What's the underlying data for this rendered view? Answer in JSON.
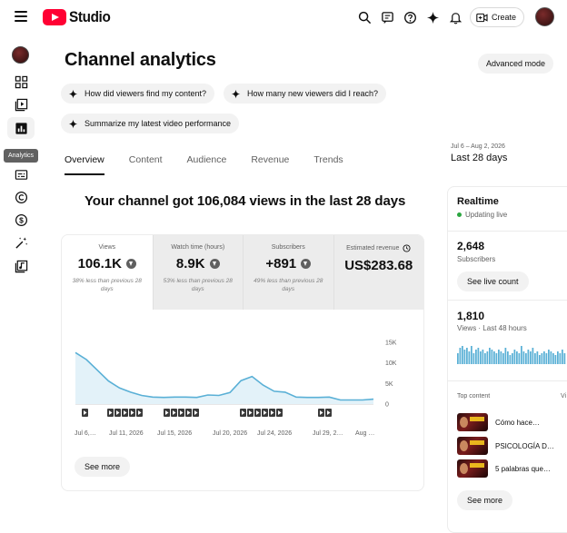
{
  "app": {
    "brand": "Studio"
  },
  "header": {
    "create_label": "Create"
  },
  "sidebar": {
    "tooltip": "Analytics",
    "items": [
      {
        "icon": "dashboard-icon"
      },
      {
        "icon": "content-icon"
      },
      {
        "icon": "analytics-icon"
      },
      {
        "icon": "comments-icon"
      },
      {
        "icon": "subtitles-icon"
      },
      {
        "icon": "copyright-icon"
      },
      {
        "icon": "earn-icon"
      },
      {
        "icon": "customization-icon"
      },
      {
        "icon": "audio-library-icon"
      }
    ]
  },
  "main": {
    "title": "Channel analytics",
    "advanced_mode_label": "Advanced mode",
    "suggestions": [
      "How did viewers find my content?",
      "How many new viewers did I reach?",
      "Summarize my latest video performance"
    ],
    "tabs": [
      "Overview",
      "Content",
      "Audience",
      "Revenue",
      "Trends"
    ],
    "active_tab": "Overview",
    "date_range": "Jul 6 – Aug 2, 2026",
    "date_label": "Last 28 days",
    "headline": "Your channel got 106,084 views in the last 28 days",
    "metrics": [
      {
        "label": "Views",
        "value": "106.1K",
        "note": "38% less than previous 28 days",
        "trend": "down"
      },
      {
        "label": "Watch time (hours)",
        "value": "8.9K",
        "note": "53% less than previous 28 days",
        "trend": "down"
      },
      {
        "label": "Subscribers",
        "value": "+891",
        "note": "49% less than previous 28 days",
        "trend": "down"
      },
      {
        "label": "Estimated revenue",
        "value": "US$283.68",
        "note": ""
      }
    ],
    "see_more_label": "See more"
  },
  "chart_data": {
    "type": "area",
    "x": [
      "Jul 6",
      "Jul 7",
      "Jul 8",
      "Jul 9",
      "Jul 10",
      "Jul 11",
      "Jul 12",
      "Jul 13",
      "Jul 14",
      "Jul 15",
      "Jul 16",
      "Jul 17",
      "Jul 18",
      "Jul 19",
      "Jul 20",
      "Jul 21",
      "Jul 22",
      "Jul 23",
      "Jul 24",
      "Jul 25",
      "Jul 26",
      "Jul 27",
      "Jul 28",
      "Jul 29",
      "Jul 30",
      "Jul 31",
      "Aug 1",
      "Aug 2"
    ],
    "series": [
      {
        "values": [
          12500,
          10800,
          8200,
          5600,
          3900,
          2900,
          2100,
          1700,
          1600,
          1700,
          1700,
          1600,
          2200,
          2100,
          2800,
          5700,
          6700,
          4600,
          3100,
          2900,
          1700,
          1600,
          1600,
          1700,
          1000,
          1000,
          1000,
          1200
        ]
      }
    ],
    "ylim": [
      0,
      15000
    ],
    "y_ticks": [
      "15K",
      "10K",
      "5K",
      "0"
    ],
    "x_tick_labels": [
      "Jul 6,…",
      "Jul 11, 2026",
      "Jul 15, 2026",
      "Jul 20, 2026",
      "Jul 24, 2026",
      "Jul 29, 2…",
      "Aug …"
    ],
    "video_markers": [
      {
        "count": 1
      },
      {
        "count": 2
      },
      {
        "count": 1
      },
      {
        "count": 1
      },
      {
        "count": 1
      },
      {
        "count": 2
      },
      {
        "count": 1
      },
      {
        "count": 1
      },
      {
        "count": 1
      },
      {
        "count": 1
      },
      {
        "count": 1
      },
      {
        "count": 1
      },
      {
        "count": 1
      },
      {
        "count": 1
      },
      {
        "count": 1
      },
      {
        "count": 1
      }
    ],
    "grid": false,
    "line_color": "#5ab0d6",
    "fill_color": "#e3f2f9"
  },
  "realtime": {
    "title": "Realtime",
    "status": "Updating live",
    "subscribers_value": "2,648",
    "subscribers_label": "Subscribers",
    "live_count_label": "See live count",
    "views_value": "1,810",
    "views_label": "Views · Last 48 hours",
    "bars": [
      6,
      9,
      10,
      8,
      9,
      7,
      10,
      6,
      8,
      9,
      7,
      8,
      6,
      7,
      9,
      8,
      7,
      6,
      8,
      7,
      6,
      9,
      7,
      5,
      6,
      8,
      7,
      6,
      10,
      7,
      6,
      8,
      7,
      9,
      6,
      7,
      5,
      6,
      7,
      6,
      8,
      7,
      6,
      5,
      7,
      6,
      8,
      6
    ],
    "top_content_label": "Top content",
    "top_content_col2": "Vi",
    "top_content": [
      "Cómo hace…",
      "PSICOLOGÍA D…",
      "5 palabras que…"
    ],
    "see_more_label": "See more",
    "accent": "#5ab0d6"
  }
}
